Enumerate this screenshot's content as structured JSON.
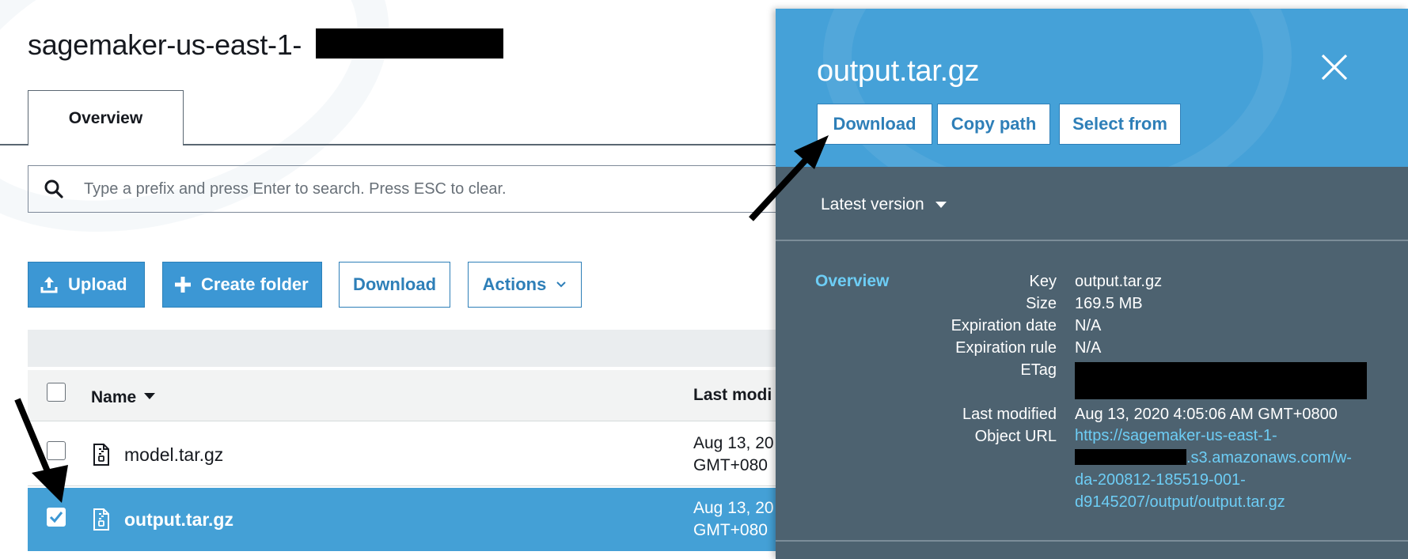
{
  "bucket": {
    "title": "sagemaker-us-east-1-"
  },
  "tabs": [
    {
      "label": "Overview"
    }
  ],
  "search": {
    "placeholder": "Type a prefix and press Enter to search. Press ESC to clear."
  },
  "toolbar": {
    "upload_label": "Upload",
    "create_folder_label": "Create folder",
    "download_label": "Download",
    "actions_label": "Actions"
  },
  "table": {
    "columns": {
      "name": "Name",
      "last_modified": "Last modi"
    },
    "rows": [
      {
        "name": "model.tar.gz",
        "date_line1": "Aug 13, 20",
        "date_line2": "GMT+080",
        "selected": false
      },
      {
        "name": "output.tar.gz",
        "date_line1": "Aug 13, 20",
        "date_line2": "GMT+080",
        "selected": true
      }
    ]
  },
  "panel": {
    "title": "output.tar.gz",
    "buttons": {
      "download": "Download",
      "copy_path": "Copy path",
      "select_from": "Select from"
    },
    "version": "Latest version",
    "overview_label": "Overview",
    "fields": {
      "key_label": "Key",
      "key_value": "output.tar.gz",
      "size_label": "Size",
      "size_value": "169.5 MB",
      "expiration_date_label": "Expiration date",
      "expiration_date_value": "N/A",
      "expiration_rule_label": "Expiration rule",
      "expiration_rule_value": "N/A",
      "etag_label": "ETag",
      "last_modified_label": "Last modified",
      "last_modified_value": "Aug 13, 2020 4:05:06 AM GMT+0800",
      "object_url_label": "Object URL",
      "object_url_line1": "https://sagemaker-us-east-1-",
      "object_url_line2": ".s3.amazonaws.com/w-",
      "object_url_line3": "da-200812-185519-001-",
      "object_url_line4": "d9145207/output/output.tar.gz"
    }
  },
  "colors": {
    "primary_blue": "#3c97d4",
    "panel_header": "#45a1d8",
    "panel_body": "#4d6270",
    "link": "#6dcdf5",
    "selected_row": "#44a0d6"
  },
  "icons": [
    "search-icon",
    "upload-icon",
    "plus-icon",
    "chevron-down-icon",
    "caret-down-icon",
    "file-archive-icon",
    "close-icon",
    "checkmark-icon"
  ]
}
